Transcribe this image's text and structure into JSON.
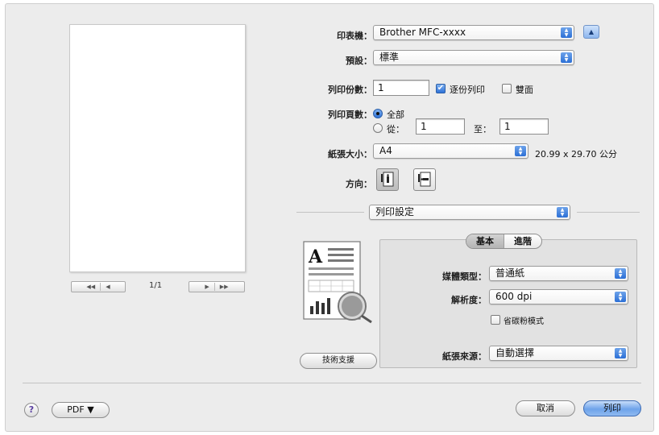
{
  "printer": {
    "label": "印表機：",
    "value": "Brother MFC-xxxx"
  },
  "presets": {
    "label": "預設：",
    "value": "標準"
  },
  "copies": {
    "label": "列印份數：",
    "value": "1",
    "collated_label": "逐份列印",
    "collated_checked": true,
    "two_sided_label": "雙面",
    "two_sided_checked": false
  },
  "pages": {
    "label": "列印頁數：",
    "all_label": "全部",
    "all_selected": true,
    "from_label": "從：",
    "from_value": "1",
    "to_label": "至：",
    "to_value": "1"
  },
  "paper_size": {
    "label": "紙張大小：",
    "value": "A4",
    "dimensions": "20.99 x 29.70 公分"
  },
  "orientation": {
    "label": "方向："
  },
  "panel_popup": {
    "value": "列印設定"
  },
  "preview": {
    "page_indicator": "1/1",
    "first_prev": "◀◀ ◀",
    "next_last": "▶ ▶▶"
  },
  "tabs": [
    {
      "label": "基本",
      "active": true
    },
    {
      "label": "進階",
      "active": false
    }
  ],
  "media_type": {
    "label": "媒體類型：",
    "value": "普通紙"
  },
  "resolution": {
    "label": "解析度：",
    "value": "600 dpi"
  },
  "toner_save": {
    "label": "省碳粉模式",
    "checked": false
  },
  "paper_source": {
    "label": "紙張來源：",
    "value": "自動選擇"
  },
  "support_button": "技術支援",
  "pdf_button": "PDF ▼",
  "help_symbol": "?",
  "cancel_button": "取消",
  "print_button": "列印",
  "icons": {
    "popup_arrows": "up-down-arrows",
    "disclosure": "triangle-up",
    "checkmark": "✔",
    "orientation_portrait": "portrait-icon",
    "orientation_landscape": "landscape-icon"
  },
  "colors": {
    "accent": "#2f72d8",
    "window": "#ececec",
    "pane": "#e2e2e2"
  }
}
